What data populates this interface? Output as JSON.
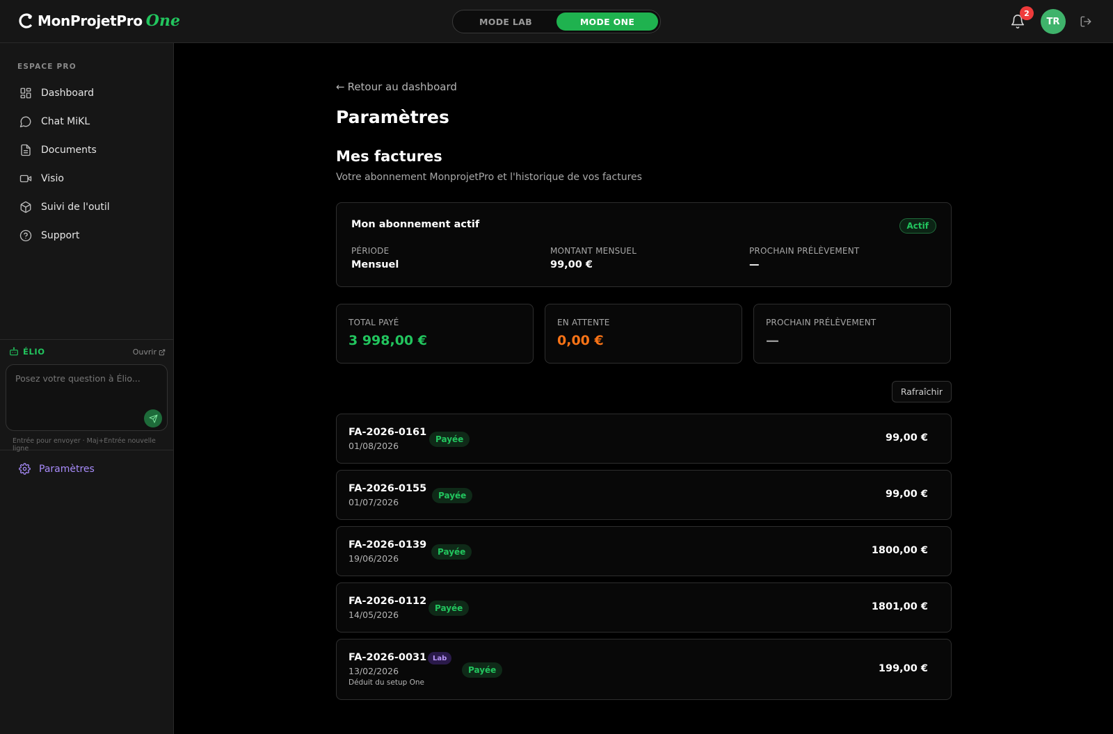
{
  "header": {
    "logo_text": "MonProjetPro",
    "logo_suffix": "One",
    "modes": [
      {
        "label": "MODE LAB",
        "active": false
      },
      {
        "label": "MODE ONE",
        "active": true
      }
    ],
    "notification_count": "2",
    "avatar_initials": "TR"
  },
  "sidebar": {
    "section_label": "ESPACE PRO",
    "items": [
      {
        "label": "Dashboard",
        "icon": "dashboard-icon"
      },
      {
        "label": "Chat MiKL",
        "icon": "chat-icon"
      },
      {
        "label": "Documents",
        "icon": "document-icon"
      },
      {
        "label": "Visio",
        "icon": "video-icon"
      },
      {
        "label": "Suivi de l'outil",
        "icon": "box-icon"
      },
      {
        "label": "Support",
        "icon": "help-icon"
      }
    ],
    "assistant": {
      "title": "ÉLIO",
      "open_label": "Ouvrir",
      "placeholder": "Posez votre question à Élio...",
      "hint": "Entrée pour envoyer · Maj+Entrée nouvelle ligne"
    },
    "settings_label": "Paramètres"
  },
  "main": {
    "back_label": "Retour au dashboard",
    "page_title": "Paramètres",
    "section_title": "Mes factures",
    "section_subtitle": "Votre abonnement MonprojetPro et l'historique de vos factures",
    "subscription": {
      "title": "Mon abonnement actif",
      "status": "Actif",
      "fields": [
        {
          "label": "PÉRIODE",
          "value": "Mensuel"
        },
        {
          "label": "MONTANT MENSUEL",
          "value": "99,00 €"
        },
        {
          "label": "PROCHAIN PRÉLÈVEMENT",
          "value": "—"
        }
      ]
    },
    "stats": [
      {
        "label": "TOTAL PAYÉ",
        "value": "3 998,00 €",
        "color": "#22c55e"
      },
      {
        "label": "EN ATTENTE",
        "value": "0,00 €",
        "color": "#f97316"
      },
      {
        "label": "PROCHAIN PRÉLÈVEMENT",
        "value": "—",
        "color": "#9a9a9a"
      }
    ],
    "refresh_label": "Rafraîchir",
    "invoices": [
      {
        "number": "FA-2026-0161",
        "date": "01/08/2026",
        "status": "Payée",
        "amount": "99,00 €"
      },
      {
        "number": "FA-2026-0155",
        "date": "01/07/2026",
        "status": "Payée",
        "amount": "99,00 €"
      },
      {
        "number": "FA-2026-0139",
        "date": "19/06/2026",
        "status": "Payée",
        "amount": "1800,00 €"
      },
      {
        "number": "FA-2026-0112",
        "date": "14/05/2026",
        "status": "Payée",
        "amount": "1801,00 €"
      },
      {
        "number": "FA-2026-0031",
        "date": "13/02/2026",
        "status": "Payée",
        "amount": "199,00 €",
        "tag": "Lab",
        "note": "Déduit du setup One"
      }
    ]
  },
  "colors": {
    "accent_green": "#22c55e",
    "settings_purple": "#a78bfa",
    "pending_orange": "#f97316",
    "badge_red": "#ef3b3b"
  }
}
